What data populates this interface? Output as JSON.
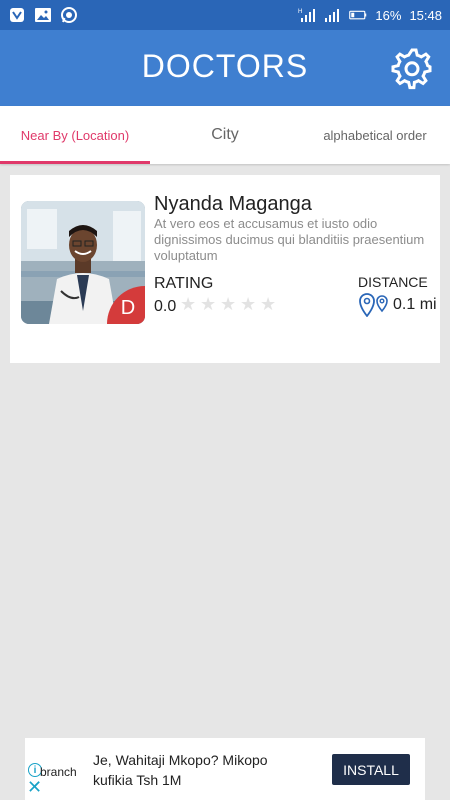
{
  "status_bar": {
    "icons_left": [
      "vpn-icon",
      "image-icon",
      "whatsapp-icon"
    ],
    "network_label": "H",
    "battery": "16%",
    "time": "15:48"
  },
  "app_bar": {
    "title": "DOCTORS",
    "settings_icon": "gear-icon"
  },
  "tabs": [
    {
      "label": "Near By (Location)",
      "active": true
    },
    {
      "label": "City",
      "active": false
    },
    {
      "label": "alphabetical order",
      "active": false
    }
  ],
  "doctor": {
    "name": "Nyanda Maganga",
    "description": "At vero eos et accusamus et iusto odio dignissimos ducimus qui blanditiis praesentium voluptatum",
    "badge": "D",
    "rating_label": "RATING",
    "rating_value": "0.0",
    "stars_filled": 0,
    "stars_total": 5,
    "distance_label": "DISTANCE",
    "distance_value": "0.1 mi"
  },
  "ad": {
    "brand": "branch",
    "text": "Je, Wahitaji Mkopo? Mikopo kufikia Tsh 1M",
    "install_label": "INSTALL"
  },
  "colors": {
    "status_bar": "#2a66b7",
    "app_bar": "#3f7fd0",
    "accent": "#e0396a",
    "badge": "#d43b3b",
    "install_button": "#1f2e4a"
  }
}
